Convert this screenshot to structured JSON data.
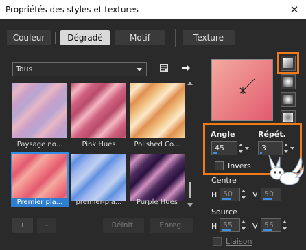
{
  "window": {
    "title": "Propriétés des styles et textures"
  },
  "tabs": [
    {
      "label": "Couleur",
      "active": false
    },
    {
      "label": "Dégradé",
      "active": true
    },
    {
      "label": "Motif",
      "active": false
    },
    {
      "label": "Texture",
      "active": false
    }
  ],
  "filter": {
    "selected": "Tous"
  },
  "gradients": [
    {
      "label": "Paysage no...",
      "colors": [
        "#b7a6d3",
        "#e8b7c4",
        "#c8a0c8"
      ]
    },
    {
      "label": "Pink Hues",
      "colors": [
        "#b84a6a",
        "#f4b6c1",
        "#d06080"
      ]
    },
    {
      "label": "Polished Co...",
      "colors": [
        "#f0c080",
        "#fce8c8",
        "#e09050"
      ]
    },
    {
      "label": "Premier pla...",
      "colors": [
        "#f4a9a0",
        "#f07f84",
        "#e25a70"
      ],
      "selected": true
    },
    {
      "label": "premier-pla...",
      "colors": [
        "#c0d0f0",
        "#6090e0",
        "#a0b8f0"
      ]
    },
    {
      "label": "Purple Hues",
      "colors": [
        "#2a1040",
        "#d090c0",
        "#503060"
      ]
    }
  ],
  "buttons": {
    "add": "+",
    "remove": "-",
    "reset": "Réinit.",
    "save": "Enreg."
  },
  "angle": {
    "label": "Angle",
    "value": "45"
  },
  "repeat": {
    "label": "Répét.",
    "value": "3"
  },
  "invert": {
    "label": "Invers",
    "checked": false
  },
  "center": {
    "label": "Centre",
    "h_label": "H",
    "h_value": "50",
    "v_label": "V",
    "v_value": "50"
  },
  "source": {
    "label": "Source",
    "h_label": "H",
    "h_value": "55",
    "v_label": "V",
    "v_value": "55"
  },
  "link": {
    "label": "Liaison",
    "checked": false
  },
  "accent": {
    "highlight": "#f07a1a",
    "selection": "#2f8fe8"
  }
}
